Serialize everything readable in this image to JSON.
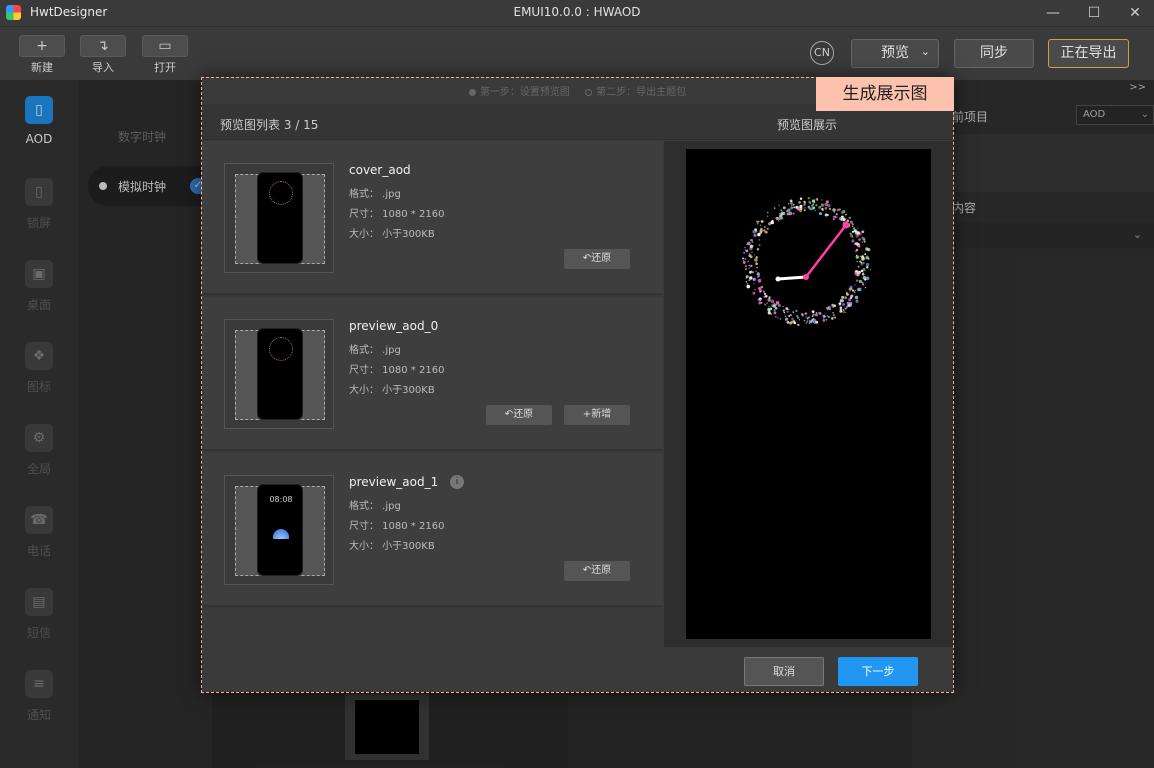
{
  "app": {
    "name": "HwtDesigner",
    "window_title": "EMUI10.0.0 : HWAOD"
  },
  "window_controls": {
    "minimize": "—",
    "maximize": "☐",
    "close": "✕"
  },
  "toolbar": {
    "new_label": "新建",
    "import_label": "导入",
    "open_label": "打开",
    "lang_badge": "CN",
    "preview_label": "预览",
    "preview_chevron": "⌄",
    "sync_label": "同步",
    "export_label": "正在导出"
  },
  "leftnav": [
    {
      "label": "AOD",
      "icon": "aod-icon"
    },
    {
      "label": "锁屏",
      "icon": "lockscreen-icon"
    },
    {
      "label": "桌面",
      "icon": "desktop-icon"
    },
    {
      "label": "图标",
      "icon": "icons-icon"
    },
    {
      "label": "全局",
      "icon": "global-icon"
    },
    {
      "label": "电话",
      "icon": "phone-icon"
    },
    {
      "label": "短信",
      "icon": "sms-icon"
    },
    {
      "label": "通知",
      "icon": "notification-icon"
    }
  ],
  "sidepanel": {
    "title": "数字时钟",
    "selected_item": "模拟时钟"
  },
  "rightpanel": {
    "arrows": ">>",
    "head1": "前项目",
    "select_value": "AOD",
    "head2": "内容"
  },
  "modal": {
    "step1": "第一步：设置预览图",
    "step2": "第二步：导出主题包",
    "badge": "生成展示图",
    "list_title": "预览图列表 3 / 15",
    "preview_title": "预览图展示",
    "items": [
      {
        "name": "cover_aod",
        "format": "格式： .jpg",
        "size": "尺寸： 1080 * 2160",
        "filesize": "大小： 小于300KB",
        "restore": "还原"
      },
      {
        "name": "preview_aod_0",
        "format": "格式： .jpg",
        "size": "尺寸： 1080 * 2160",
        "filesize": "大小： 小于300KB",
        "restore": "还原",
        "add": "新增"
      },
      {
        "name": "preview_aod_1",
        "format": "格式： .jpg",
        "size": "尺寸： 1080 * 2160",
        "filesize": "大小： 小于300KB",
        "restore": "还原",
        "thumb_time": "08:08"
      }
    ],
    "cancel_label": "取消",
    "next_label": "下一步"
  },
  "colors": {
    "accent_blue": "#2196f3",
    "badge_bg": "#fcc2ad",
    "dashed_border": "#f0b0a0",
    "clock_hand": "#ff3fa6"
  }
}
